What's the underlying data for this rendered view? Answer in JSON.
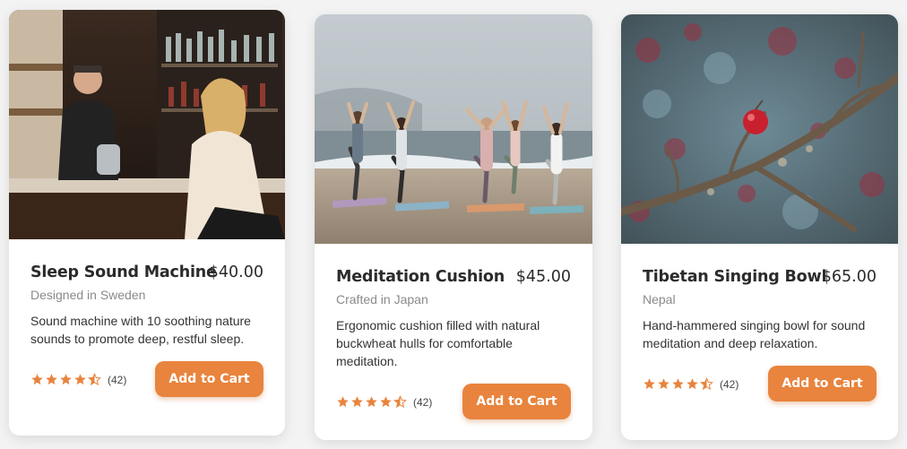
{
  "products": [
    {
      "image_alt": "bartender-photo",
      "title": "Sleep Sound Machine",
      "price": "$40.00",
      "origin": "Designed in Sweden",
      "description": "Sound machine with 10 soothing nature sounds to promote deep, restful sleep.",
      "rating": 4.5,
      "rating_count": "(42)",
      "button_label": "Add to Cart"
    },
    {
      "image_alt": "beach-yoga-photo",
      "title": "Meditation Cushion",
      "price": "$45.00",
      "origin": "Crafted in Japan",
      "description": "Ergonomic cushion filled with natural buckwheat hulls for comfortable meditation.",
      "rating": 4.5,
      "rating_count": "(42)",
      "button_label": "Add to Cart"
    },
    {
      "image_alt": "berry-branch-photo",
      "title": "Tibetan Singing Bowl",
      "price": "$65.00",
      "origin": "Nepal",
      "description": "Hand-hammered singing bowl for sound meditation and deep relaxation.",
      "rating": 4.5,
      "rating_count": "(42)",
      "button_label": "Add to Cart"
    }
  ],
  "colors": {
    "accent": "#e8843e",
    "star": "#e8843e",
    "card_bg": "#ffffff",
    "page_bg": "#f3f3f3"
  }
}
